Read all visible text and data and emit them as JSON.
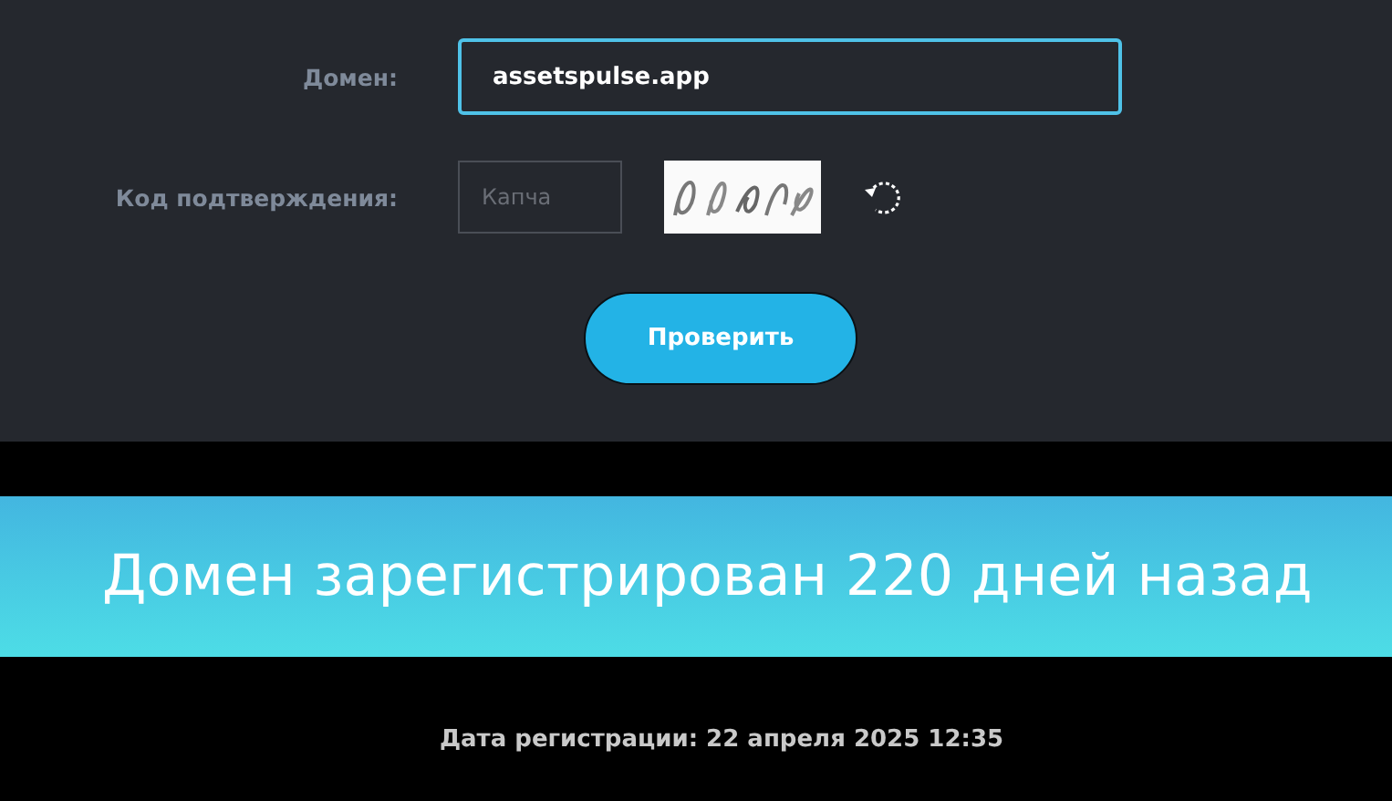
{
  "form": {
    "domain_label": "Домен:",
    "domain_value": "assetspulse.app",
    "captcha_label": "Код подтверждения:",
    "captcha_placeholder": "Капча",
    "submit": "Проверить"
  },
  "result": {
    "banner": "Домен зарегистрирован 220 дней назад",
    "registration_date": "Дата регистрации: 22 апреля 2025 12:35"
  }
}
